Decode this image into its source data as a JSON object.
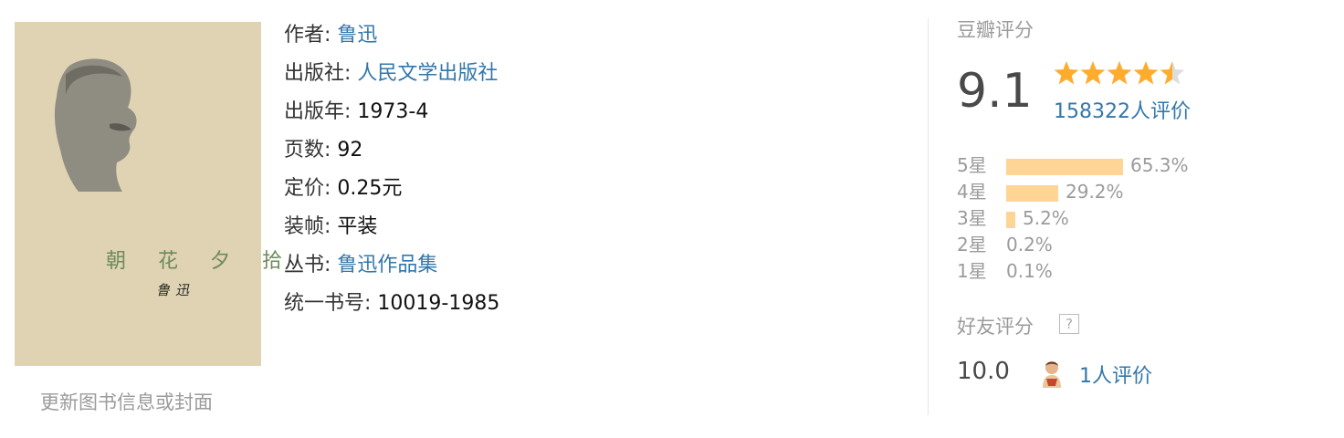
{
  "cover": {
    "title": "朝 花 夕 拾",
    "author_signature": "鲁迅",
    "update_link": "更新图书信息或封面"
  },
  "info": [
    {
      "label": "作者:",
      "value": "鲁迅",
      "link": true
    },
    {
      "label": "出版社:",
      "value": "人民文学出版社",
      "link": true
    },
    {
      "label": "出版年:",
      "value": "1973-4",
      "link": false
    },
    {
      "label": "页数:",
      "value": "92",
      "link": false
    },
    {
      "label": "定价:",
      "value": "0.25元",
      "link": false
    },
    {
      "label": "装帧:",
      "value": "平装",
      "link": false
    },
    {
      "label": "丛书:",
      "value": "鲁迅作品集",
      "link": true
    },
    {
      "label": "统一书号:",
      "value": "10019-1985",
      "link": false
    }
  ],
  "rating": {
    "title": "豆瓣评分",
    "score": "9.1",
    "stars": 4.5,
    "count_text": "158322人评价",
    "distribution": [
      {
        "label": "5星",
        "percent": 65.3,
        "text": "65.3%"
      },
      {
        "label": "4星",
        "percent": 29.2,
        "text": "29.2%"
      },
      {
        "label": "3星",
        "percent": 5.2,
        "text": "5.2%"
      },
      {
        "label": "2星",
        "percent": 0.2,
        "text": "0.2%"
      },
      {
        "label": "1星",
        "percent": 0.1,
        "text": "0.1%"
      }
    ]
  },
  "friends": {
    "title": "好友评分",
    "help_icon": "?",
    "score": "10.0",
    "count_text": "1人评价"
  },
  "colors": {
    "link": "#3377aa",
    "star": "#ffac2d",
    "bar": "#ffd596",
    "muted": "#9b9b9b"
  }
}
